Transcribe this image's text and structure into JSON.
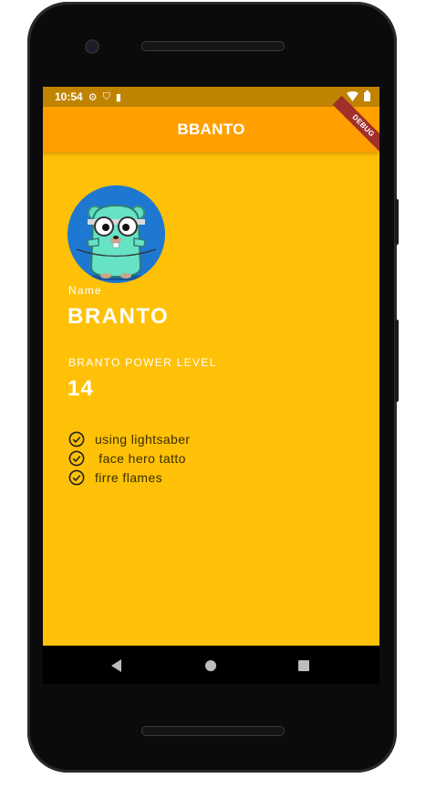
{
  "status_bar": {
    "time": "10:54",
    "left_icons": [
      "gear-icon",
      "shield-icon",
      "sim-card-icon"
    ],
    "right_icons": [
      "wifi-icon",
      "battery-icon"
    ]
  },
  "app_bar": {
    "title": "BBANTO",
    "color": "#ffa000",
    "debug_banner": "DEBUG"
  },
  "profile": {
    "avatar": "gopher-avatar",
    "name_label": "Name",
    "name_value": "BRANTO",
    "power_label": "BRANTO POWER LEVEL",
    "power_value": "14",
    "background_color": "#ffc107"
  },
  "skills": [
    {
      "icon": "check-circle-icon",
      "label": "using lightsaber"
    },
    {
      "icon": "check-circle-icon",
      "label": " face hero tatto"
    },
    {
      "icon": "check-circle-icon",
      "label": "firre flames"
    }
  ],
  "nav_bar": {
    "buttons": [
      "back-icon",
      "home-icon",
      "recents-icon"
    ]
  }
}
